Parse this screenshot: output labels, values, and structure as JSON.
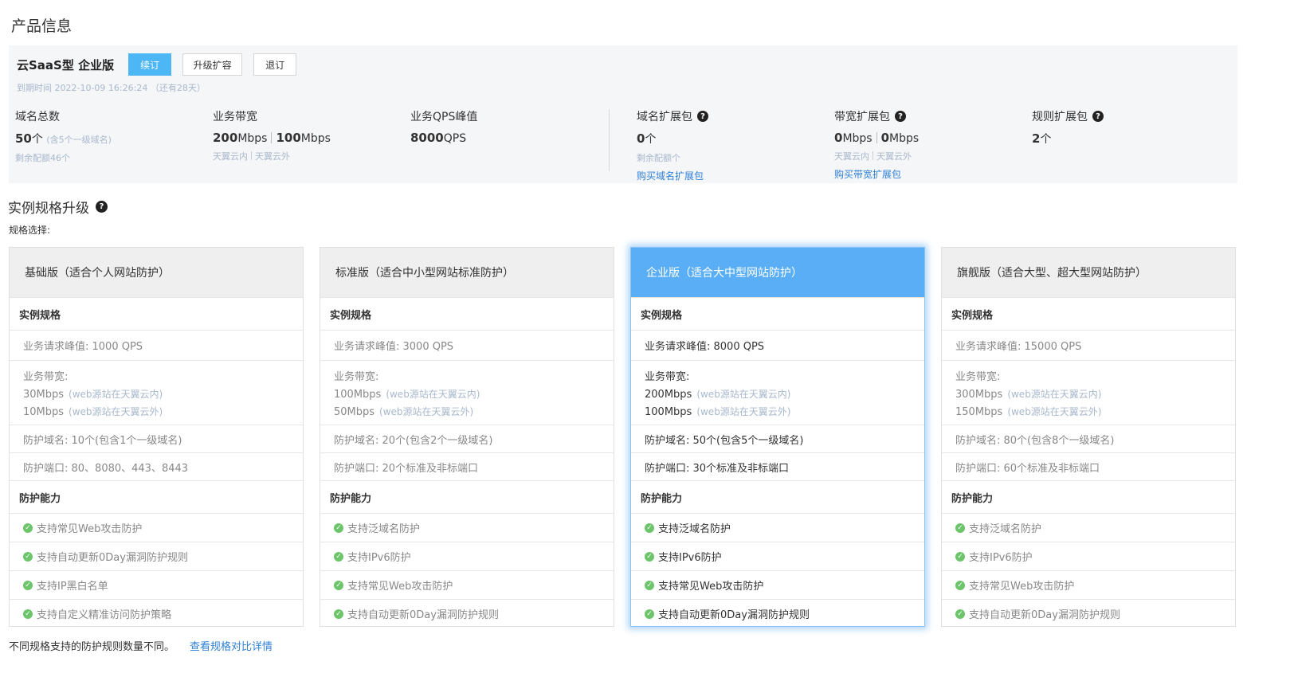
{
  "page_title": "产品信息",
  "product": {
    "name": "云SaaS型 企业版",
    "renew_label": "续订",
    "upgrade_label": "升级扩容",
    "cancel_label": "退订",
    "expire_text": "到期时间 2022-10-09 16:26:24  （还有28天）"
  },
  "metrics": {
    "domains": {
      "label": "域名总数",
      "value": "50",
      "unit": "个",
      "note": "(含5个一级域名)",
      "sub": "剩余配额46个"
    },
    "bandwidth": {
      "label": "业务带宽",
      "v1": "200",
      "u1": "Mbps",
      "v2": "100",
      "u2": "Mbps",
      "sub1": "天翼云内",
      "sub2": "天翼云外"
    },
    "qps": {
      "label": "业务QPS峰值",
      "value": "8000",
      "unit": "QPS"
    },
    "domain_pack": {
      "label": "域名扩展包",
      "value": "0",
      "unit": "个",
      "sub": "剩余配额个",
      "link": "购买域名扩展包"
    },
    "bw_pack": {
      "label": "带宽扩展包",
      "v1": "0",
      "u1": "Mbps",
      "v2": "0",
      "u2": "Mbps",
      "sub1": "天翼云内",
      "sub2": "天翼云外",
      "link": "购买带宽扩展包"
    },
    "rule_pack": {
      "label": "规则扩展包",
      "value": "2",
      "unit": "个"
    }
  },
  "help_glyph": "?",
  "section_title": "实例规格升级",
  "spec_select_label": "规格选择:",
  "group_spec": "实例规格",
  "group_protect": "防护能力",
  "cloud_in_note": "(web源站在天翼云内)",
  "cloud_out_note": "(web源站在天翼云外)",
  "bw_label": "业务带宽:",
  "check_glyph": "✓",
  "plans": [
    {
      "title": "基础版（适合个人网站防护）",
      "qps": "业务请求峰值: 1000 QPS",
      "bw_in": "30Mbps",
      "bw_out": "10Mbps",
      "domains": "防护域名: 10个(包含1个一级域名)",
      "ports": "防护端口: 80、8080、443、8443",
      "features": [
        "支持常见Web攻击防护",
        "支持自动更新0Day漏洞防护规则",
        "支持IP黑白名单",
        "支持自定义精准访问防护策略"
      ]
    },
    {
      "title": "标准版（适合中小型网站标准防护）",
      "qps": "业务请求峰值: 3000 QPS",
      "bw_in": "100Mbps",
      "bw_out": "50Mbps",
      "domains": "防护域名: 20个(包含2个一级域名)",
      "ports": "防护端口: 20个标准及非标端口",
      "features": [
        "支持泛域名防护",
        "支持IPv6防护",
        "支持常见Web攻击防护",
        "支持自动更新0Day漏洞防护规则"
      ]
    },
    {
      "title": "企业版（适合大中型网站防护）",
      "qps": "业务请求峰值: 8000 QPS",
      "bw_in": "200Mbps",
      "bw_out": "100Mbps",
      "domains": "防护域名: 50个(包含5个一级域名)",
      "ports": "防护端口: 30个标准及非标端口",
      "features": [
        "支持泛域名防护",
        "支持IPv6防护",
        "支持常见Web攻击防护",
        "支持自动更新0Day漏洞防护规则"
      ]
    },
    {
      "title": "旗舰版（适合大型、超大型网站防护）",
      "qps": "业务请求峰值: 15000 QPS",
      "bw_in": "300Mbps",
      "bw_out": "150Mbps",
      "domains": "防护域名: 80个(包含8个一级域名)",
      "ports": "防护端口: 60个标准及非标端口",
      "features": [
        "支持泛域名防护",
        "支持IPv6防护",
        "支持常见Web攻击防护",
        "支持自动更新0Day漏洞防护规则"
      ]
    }
  ],
  "footer_note": "不同规格支持的防护规则数量不同。",
  "footer_link": "查看规格对比详情",
  "colors": {
    "accent": "#4db6f5",
    "selected_header": "#5aaef5",
    "link": "#2f80d6",
    "check": "#6cc56b"
  }
}
